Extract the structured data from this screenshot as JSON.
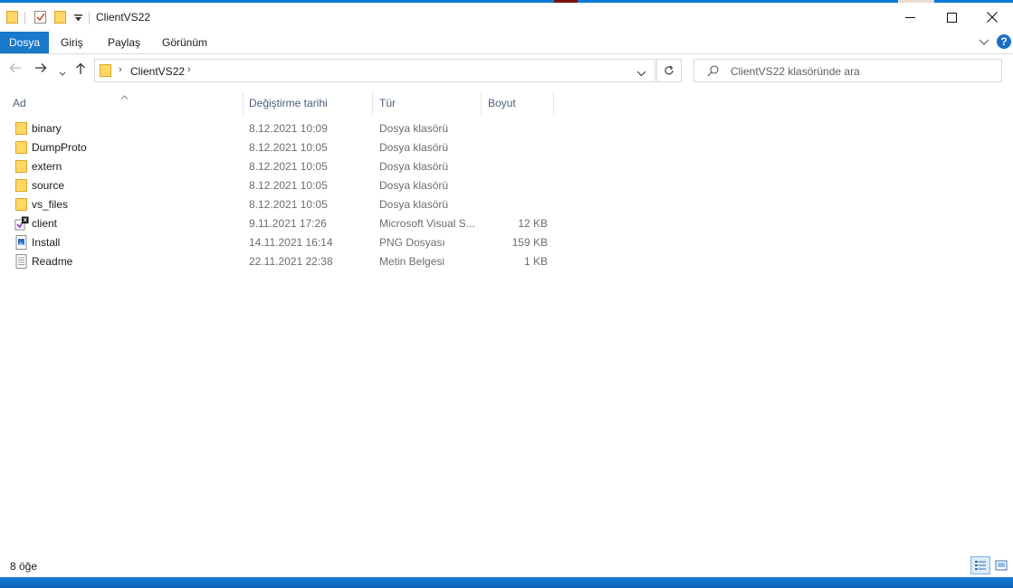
{
  "window": {
    "title": "ClientVS22"
  },
  "ribbon": {
    "tabs": [
      "Dosya",
      "Giriş",
      "Paylaş",
      "Görünüm"
    ],
    "help_label": "?"
  },
  "address": {
    "crumb": "ClientVS22"
  },
  "search": {
    "placeholder": "ClientVS22 klasöründe ara"
  },
  "columns": {
    "name": "Ad",
    "date": "Değiştirme tarihi",
    "type": "Tür",
    "size": "Boyut"
  },
  "files": [
    {
      "name": "binary",
      "date": "8.12.2021 10:09",
      "type": "Dosya klasörü",
      "size": "",
      "icon": "folder-icon"
    },
    {
      "name": "DumpProto",
      "date": "8.12.2021 10:05",
      "type": "Dosya klasörü",
      "size": "",
      "icon": "folder-icon"
    },
    {
      "name": "extern",
      "date": "8.12.2021 10:05",
      "type": "Dosya klasörü",
      "size": "",
      "icon": "folder-icon"
    },
    {
      "name": "source",
      "date": "8.12.2021 10:05",
      "type": "Dosya klasörü",
      "size": "",
      "icon": "folder-icon"
    },
    {
      "name": "vs_files",
      "date": "8.12.2021 10:05",
      "type": "Dosya klasörü",
      "size": "",
      "icon": "folder-icon"
    },
    {
      "name": "client",
      "date": "9.11.2021 17:26",
      "type": "Microsoft Visual S...",
      "size": "12 KB",
      "icon": "visual-studio-solution-icon"
    },
    {
      "name": "Install",
      "date": "14.11.2021 16:14",
      "type": "PNG Dosyası",
      "size": "159 KB",
      "icon": "image-file-icon"
    },
    {
      "name": "Readme",
      "date": "22.11.2021 22:38",
      "type": "Metin Belgesi",
      "size": "1 KB",
      "icon": "text-file-icon"
    }
  ],
  "status": {
    "item_count": "8 öğe"
  },
  "colors": {
    "accent": "#1979ca",
    "folder": "#ffd767",
    "header_text": "#4c607a",
    "taskbar": "#0c62b8"
  }
}
